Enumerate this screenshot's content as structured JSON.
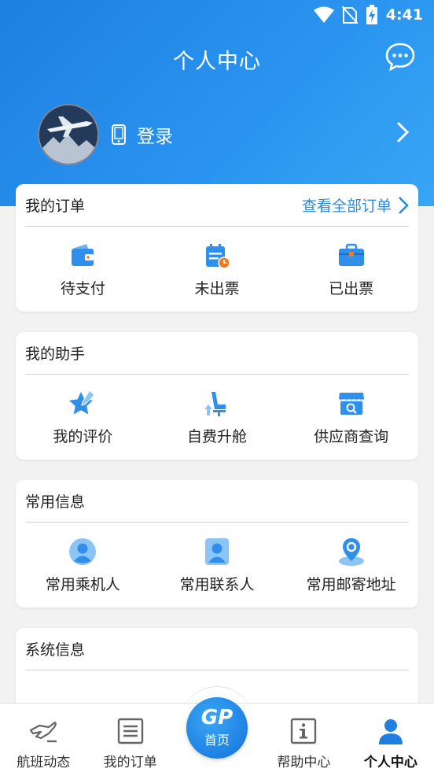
{
  "status": {
    "time": "4:41"
  },
  "header": {
    "title": "个人中心"
  },
  "profile": {
    "login": "登录"
  },
  "orders": {
    "title": "我的订单",
    "view_all": "查看全部订单",
    "items": [
      {
        "label": "待支付",
        "icon": "wallet-icon"
      },
      {
        "label": "未出票",
        "icon": "calendar-clock-icon"
      },
      {
        "label": "已出票",
        "icon": "briefcase-icon"
      }
    ]
  },
  "assistant": {
    "title": "我的助手",
    "items": [
      {
        "label": "我的评价",
        "icon": "star-pen-icon"
      },
      {
        "label": "自费升舱",
        "icon": "seat-upgrade-icon"
      },
      {
        "label": "供应商查询",
        "icon": "store-search-icon"
      }
    ]
  },
  "common": {
    "title": "常用信息",
    "items": [
      {
        "label": "常用乘机人",
        "icon": "passenger-icon"
      },
      {
        "label": "常用联系人",
        "icon": "contact-icon"
      },
      {
        "label": "常用邮寄地址",
        "icon": "location-icon"
      }
    ]
  },
  "system": {
    "title": "系统信息"
  },
  "tabbar": {
    "items": [
      {
        "label": "航班动态",
        "icon": "flight-status-icon"
      },
      {
        "label": "我的订单",
        "icon": "order-list-icon"
      },
      {
        "label": "首页",
        "logo": "GP",
        "icon": "home-logo-icon"
      },
      {
        "label": "帮助中心",
        "icon": "info-icon"
      },
      {
        "label": "个人中心",
        "icon": "user-icon"
      }
    ]
  },
  "colors": {
    "primary": "#1e7fe0",
    "accent": "#2a8ae6",
    "icon_blue": "#2f8fea",
    "icon_orange": "#f07a21"
  }
}
